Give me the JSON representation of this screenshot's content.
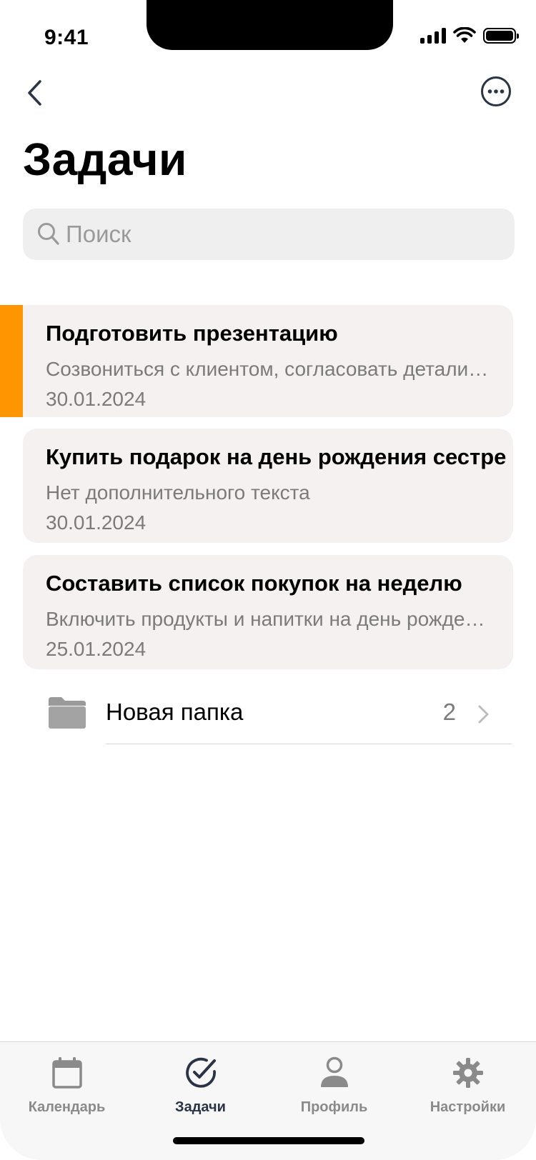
{
  "status_bar": {
    "time": "9:41"
  },
  "header": {
    "title": "Задачи"
  },
  "search": {
    "placeholder": "Поиск"
  },
  "tasks": [
    {
      "title": "Подготовить презентацию",
      "description": "Созвониться с клиентом, согласовать детали,...",
      "date": "30.01.2024",
      "priority_color": "#ff9500"
    },
    {
      "title": "Купить подарок на день рождения сестре",
      "description": "Нет дополнительного текста",
      "date": "30.01.2024"
    },
    {
      "title": "Составить список покупок на неделю",
      "description": "Включить продукты и напитки на день рожден...",
      "date": "25.01.2024"
    }
  ],
  "folders": [
    {
      "name": "Новая папка",
      "count": "2"
    }
  ],
  "tab_bar": {
    "items": [
      {
        "label": "Календарь",
        "icon": "calendar-icon"
      },
      {
        "label": "Задачи",
        "icon": "check-circle-icon",
        "active": true
      },
      {
        "label": "Профиль",
        "icon": "person-icon"
      },
      {
        "label": "Настройки",
        "icon": "gear-icon"
      }
    ]
  },
  "colors": {
    "accent": "#ff9500",
    "icon_dark": "#2b3445",
    "card_bg": "#f4f1f0"
  }
}
